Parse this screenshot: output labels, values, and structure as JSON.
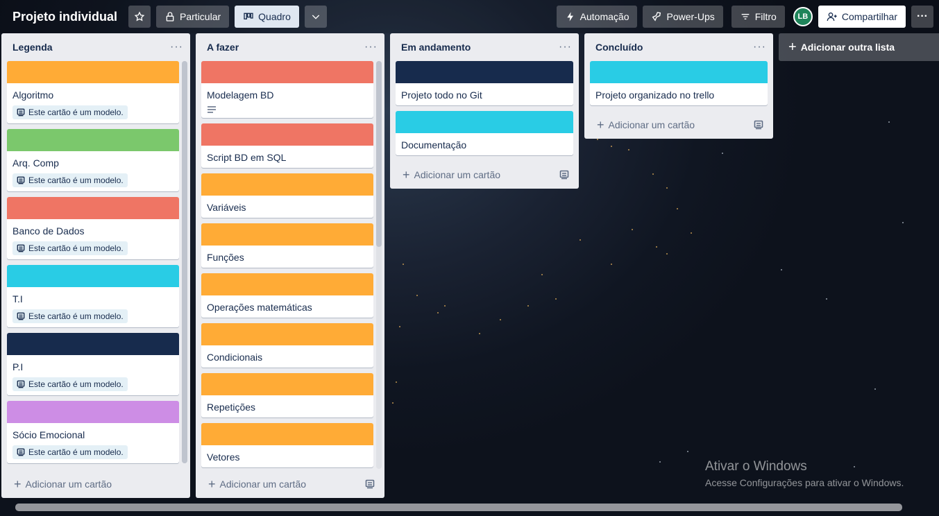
{
  "header": {
    "board_title": "Projeto individual",
    "visibility": "Particular",
    "view": "Quadro",
    "automation": "Automação",
    "powerups": "Power-Ups",
    "filter": "Filtro",
    "avatar_initials": "LB",
    "share": "Compartilhar"
  },
  "labels": {
    "add_card": "Adicionar um cartão",
    "template_badge": "Este cartão é um modelo.",
    "add_list": "Adicionar outra lista",
    "list_menu": "···"
  },
  "lists": [
    {
      "title": "Legenda",
      "cards": [
        {
          "title": "Algoritmo",
          "cover": "#ffab36",
          "template": true
        },
        {
          "title": "Arq. Comp",
          "cover": "#7bc86c",
          "template": true
        },
        {
          "title": "Banco de Dados",
          "cover": "#ef7564",
          "template": true
        },
        {
          "title": "T.I",
          "cover": "#29cce5",
          "template": true
        },
        {
          "title": "P.I",
          "cover": "#172b4d",
          "template": true
        },
        {
          "title": "Sócio Emocional",
          "cover": "#cd8de5",
          "template": true
        }
      ]
    },
    {
      "title": "A fazer",
      "cards": [
        {
          "title": "Modelagem BD",
          "cover": "#ef7564",
          "description": true
        },
        {
          "title": "Script BD em SQL",
          "cover": "#ef7564"
        },
        {
          "title": "Variáveis",
          "cover": "#ffab36"
        },
        {
          "title": "Funções",
          "cover": "#ffab36"
        },
        {
          "title": "Operações matemáticas",
          "cover": "#ffab36"
        },
        {
          "title": "Condicionais",
          "cover": "#ffab36"
        },
        {
          "title": "Repetições",
          "cover": "#ffab36"
        },
        {
          "title": "Vetores",
          "cover": "#ffab36"
        }
      ]
    },
    {
      "title": "Em andamento",
      "cards": [
        {
          "title": "Projeto todo no Git",
          "cover": "#172b4d"
        },
        {
          "title": "Documentação",
          "cover": "#29cce5"
        }
      ]
    },
    {
      "title": "Concluído",
      "cards": [
        {
          "title": "Projeto organizado no trello",
          "cover": "#29cce5"
        }
      ]
    }
  ],
  "watermark": {
    "line1": "Ativar o Windows",
    "line2": "Acesse Configurações para ativar o Windows."
  }
}
